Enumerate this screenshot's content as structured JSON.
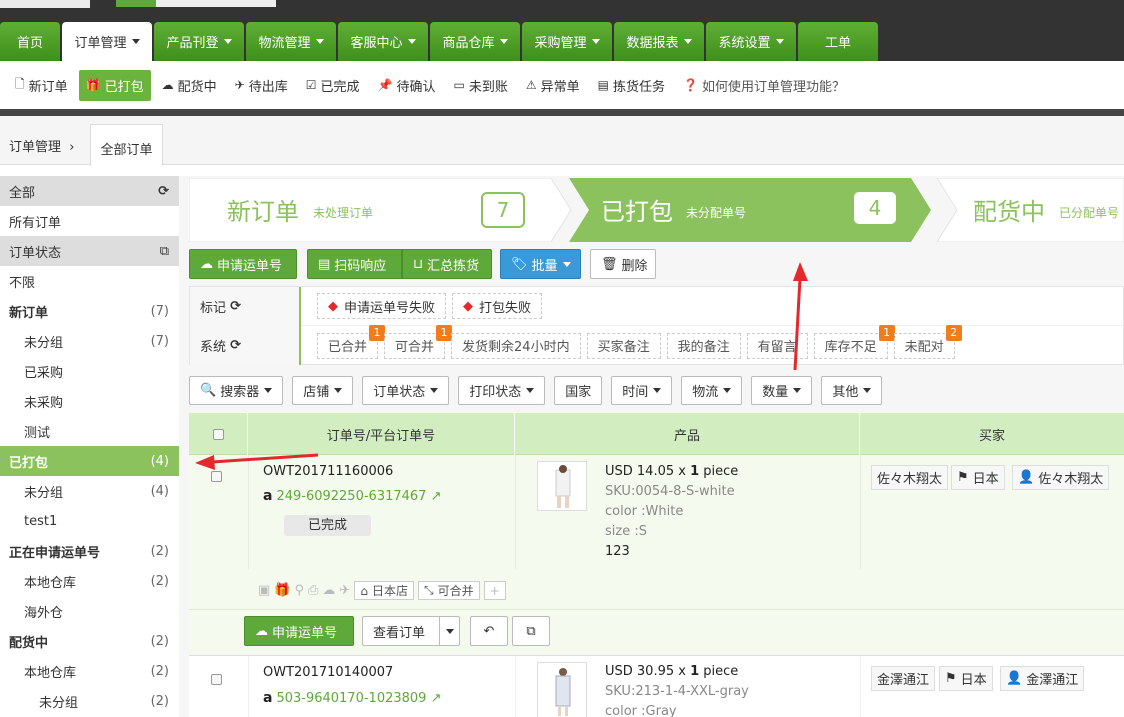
{
  "nav": {
    "tabs": [
      {
        "label": "首页"
      },
      {
        "label": "订单管理"
      },
      {
        "label": "产品刊登"
      },
      {
        "label": "物流管理"
      },
      {
        "label": "客服中心"
      },
      {
        "label": "商品仓库"
      },
      {
        "label": "采购管理"
      },
      {
        "label": "数据报表"
      },
      {
        "label": "系统设置"
      },
      {
        "label": "工单"
      }
    ]
  },
  "subnav": {
    "items": [
      {
        "label": "新订单",
        "icon": "document-icon"
      },
      {
        "label": "已打包",
        "icon": "gift-icon"
      },
      {
        "label": "配货中",
        "icon": "cloud-upload-icon"
      },
      {
        "label": "待出库",
        "icon": "plane-icon"
      },
      {
        "label": "已完成",
        "icon": "check-square-icon"
      },
      {
        "label": "待确认",
        "icon": "pin-icon"
      },
      {
        "label": "未到账",
        "icon": "card-icon"
      },
      {
        "label": "异常单",
        "icon": "warning-icon"
      },
      {
        "label": "拣货任务",
        "icon": "barcode-icon"
      }
    ],
    "help": "如何使用订单管理功能？"
  },
  "breadcrumb": {
    "root": "订单管理",
    "current": "全部订单"
  },
  "sidebar": {
    "all": "全部",
    "all_orders": "所有订单",
    "status_header": "订单状态",
    "rows": [
      {
        "label": "不限",
        "count": ""
      },
      {
        "label": "新订单",
        "count": "(7)"
      },
      {
        "label": "未分组",
        "count": "(7)"
      },
      {
        "label": "已采购",
        "count": ""
      },
      {
        "label": "未采购",
        "count": ""
      },
      {
        "label": "测试",
        "count": ""
      },
      {
        "label": "已打包",
        "count": "(4)"
      },
      {
        "label": "未分组",
        "count": "(4)"
      },
      {
        "label": "test1",
        "count": ""
      },
      {
        "label": "正在申请运单号",
        "count": "(2)"
      },
      {
        "label": "本地仓库",
        "count": "(2)"
      },
      {
        "label": "海外仓",
        "count": ""
      },
      {
        "label": "配货中",
        "count": "(2)"
      },
      {
        "label": "本地仓库",
        "count": "(2)"
      },
      {
        "label": "未分组",
        "count": "(2)"
      }
    ]
  },
  "steps": [
    {
      "title": "新订单",
      "sub": "未处理订单",
      "count": "7"
    },
    {
      "title": "已打包",
      "sub": "未分配单号",
      "count": "4"
    },
    {
      "title": "配货中",
      "sub": "已分配单号"
    }
  ],
  "actions": {
    "apply": "申请运单号",
    "scan": "扫码响应",
    "summary": "汇总拣货",
    "batch": "批量",
    "delete": "删除"
  },
  "tags": {
    "mark_label": "标记",
    "mark_items": [
      "申请运单号失败",
      "打包失败"
    ],
    "system_label": "系统",
    "system_items": [
      {
        "label": "已合并",
        "badge": "1"
      },
      {
        "label": "可合并",
        "badge": "1"
      },
      {
        "label": "发货剩余24小时内",
        "badge": ""
      },
      {
        "label": "买家备注",
        "badge": ""
      },
      {
        "label": "我的备注",
        "badge": ""
      },
      {
        "label": "有留言",
        "badge": ""
      },
      {
        "label": "库存不足",
        "badge": "1"
      },
      {
        "label": "未配对",
        "badge": "2"
      }
    ]
  },
  "filters": [
    "搜索器",
    "店铺",
    "订单状态",
    "打印状态",
    "国家",
    "时间",
    "物流",
    "数量",
    "其他"
  ],
  "table": {
    "headers": {
      "order": "订单号/平台订单号",
      "product": "产品",
      "buyer": "买家"
    }
  },
  "orders": [
    {
      "order_no": "OWT201711160006",
      "platform_no": "249-6092250-6317467",
      "status": "已完成",
      "price": "USD 14.05 x ",
      "qty": "1",
      "unit": " piece",
      "sku": "SKU:0054-8-S-white",
      "color": "color :White",
      "size": "size :S",
      "note": "123",
      "shop_tag": "日本店",
      "merge_tag": "可合并",
      "buyer_name": "佐々木翔太",
      "country": "日本",
      "buyer_user": "佐々木翔太",
      "btn_apply": "申请运单号",
      "btn_view": "查看订单"
    },
    {
      "order_no": "OWT201710140007",
      "platform_no": "503-9640170-1023809",
      "price": "USD 30.95 x ",
      "qty": "1",
      "unit": " piece",
      "sku": "SKU:213-1-4-XXL-gray",
      "color": "color :Gray",
      "buyer_name": "金澤通江",
      "country": "日本",
      "buyer_user": "金澤通江"
    }
  ]
}
